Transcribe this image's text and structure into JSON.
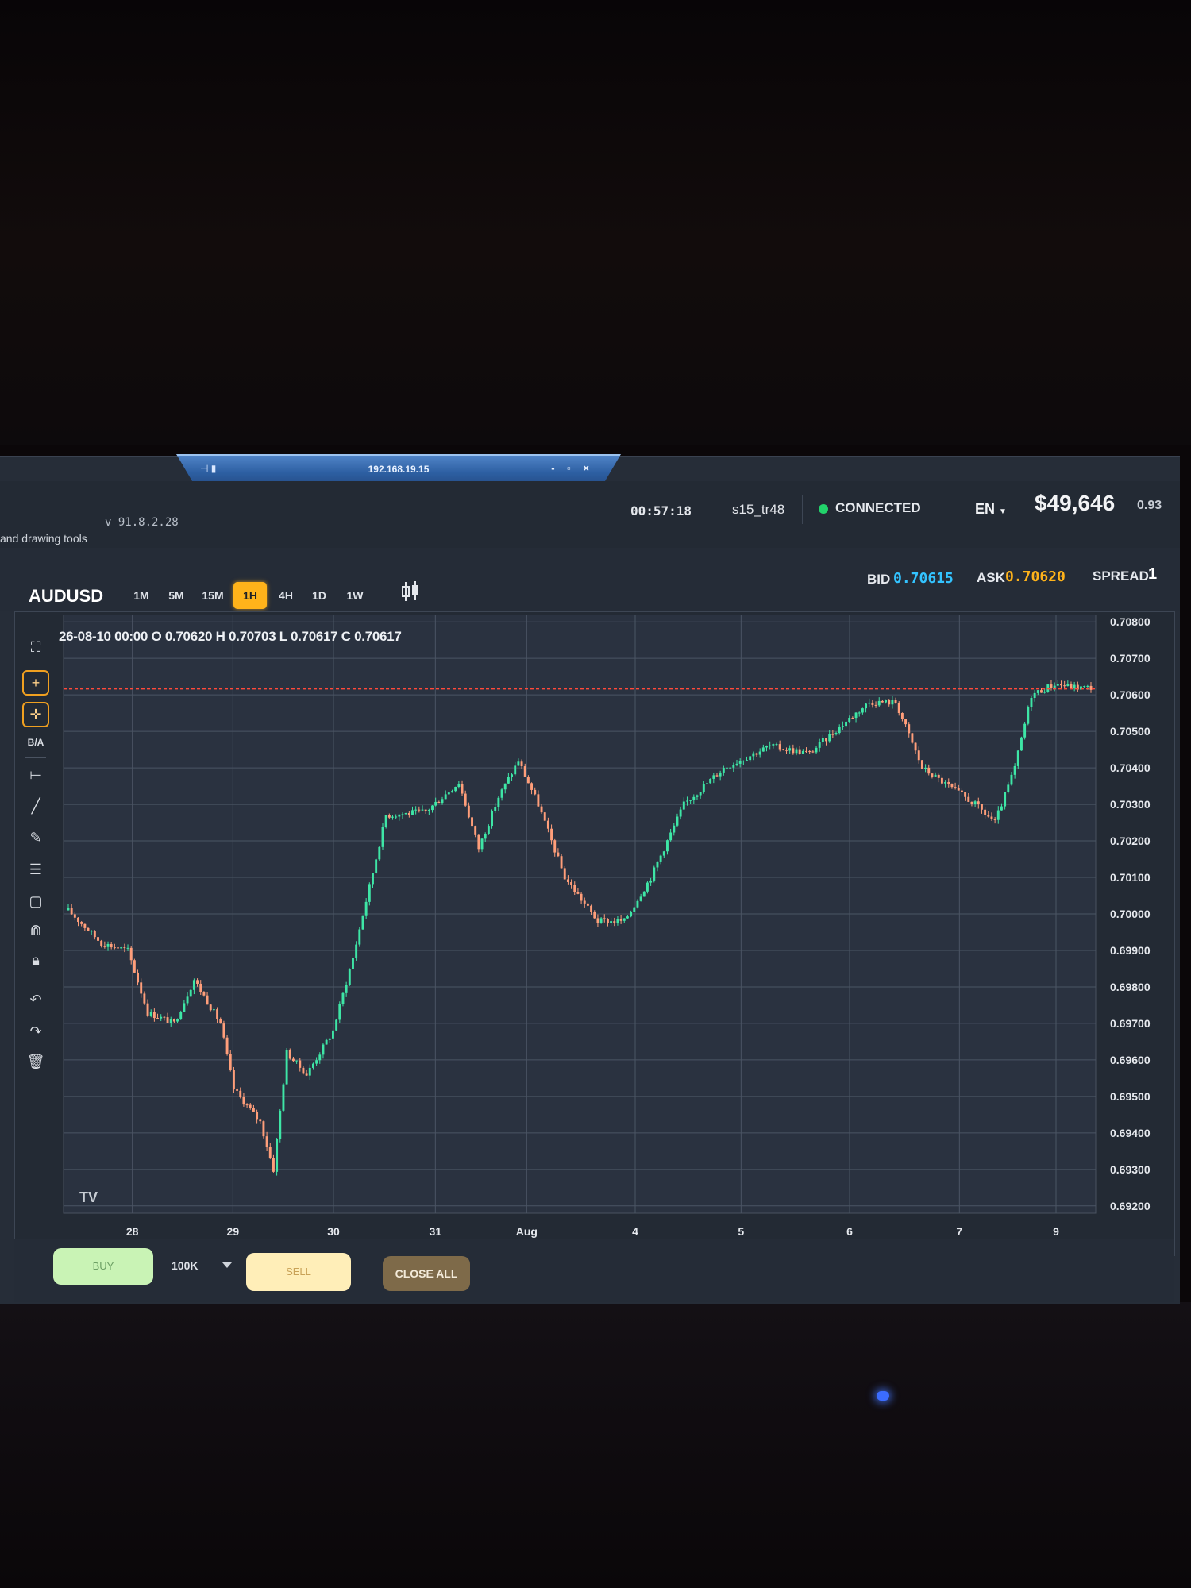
{
  "remote": {
    "ip": "192.168.19.15",
    "pin": "⊣ ▮",
    "controls": "- ▫ ×"
  },
  "status": {
    "version": "v 91.8.2.28",
    "hint": "and drawing tools",
    "clock": "00:57:18",
    "account": "s15_tr48",
    "connection": "CONNECTED",
    "connection_color": "#22d36b",
    "language": "EN",
    "balance": "$49,646",
    "balance_extra": "0.93"
  },
  "toolbar": {
    "symbol": "AUDUSD",
    "timeframes": [
      "1M",
      "5M",
      "15M",
      "1H",
      "4H",
      "1D",
      "1W"
    ],
    "active_timeframe": "1H",
    "chart_type_icon": "candlestick-icon"
  },
  "quote": {
    "bid_label": "BID",
    "bid": "0.70615",
    "ask_label": "ASK",
    "ask": "0.70620",
    "spread_label": "SPREAD",
    "spread": "1",
    "bid_color": "#33c3ff",
    "ask_color": "#ffb31a"
  },
  "ohlc_readout": "26-08-10 00:00 O 0.70620 H 0.70703 L 0.70617 C 0.70617",
  "drawing_tools": [
    "fullscreen-icon",
    "crosshair-icon",
    "crosshair-alt-icon",
    "B/A",
    "horizontal-line-icon",
    "trend-line-icon",
    "pencil-icon",
    "fibonacci-icon",
    "rectangle-icon",
    "magnet-icon",
    "lock-icon",
    "undo-icon",
    "redo-icon",
    "trash-icon"
  ],
  "watermark": "TV",
  "trade": {
    "buy_label": "BUY",
    "lot_size": "100K",
    "sell_label": "SELL",
    "close_all_label": "CLOSE ALL",
    "buy_color": "#c9f3b5",
    "sell_color": "#ffeeb8"
  },
  "chart_data": {
    "type": "candlestick",
    "symbol": "AUDUSD",
    "timeframe": "1H",
    "y_ticks": [
      0.708,
      0.707,
      0.706,
      0.705,
      0.704,
      0.703,
      0.702,
      0.701,
      0.7,
      0.699,
      0.698,
      0.697,
      0.696,
      0.695,
      0.694,
      0.693,
      0.692
    ],
    "y_tick_labels": [
      "0.70800",
      "0.70700",
      "0.70600",
      "0.70500",
      "0.70400",
      "0.70300",
      "0.70200",
      "0.70100",
      "0.70000",
      "0.69900",
      "0.69800",
      "0.69700",
      "0.69600",
      "0.69500",
      "0.69400",
      "0.69300",
      "0.69200"
    ],
    "ylim": [
      0.6918,
      0.7082
    ],
    "x_ticks": [
      "28",
      "29",
      "30",
      "31",
      "Aug",
      "4",
      "5",
      "6",
      "7",
      "9"
    ],
    "price_line": 0.70617,
    "price_line_color": "#ff4a3a",
    "up_color": "#3ee6a6",
    "down_color": "#ff9e7a",
    "grid": true,
    "close_path": [
      [
        0,
        0.7001
      ],
      [
        10,
        0.6992
      ],
      [
        18,
        0.699
      ],
      [
        24,
        0.6973
      ],
      [
        32,
        0.697
      ],
      [
        38,
        0.6982
      ],
      [
        46,
        0.697
      ],
      [
        50,
        0.6952
      ],
      [
        58,
        0.6943
      ],
      [
        62,
        0.693
      ],
      [
        66,
        0.6962
      ],
      [
        72,
        0.6956
      ],
      [
        80,
        0.6968
      ],
      [
        86,
        0.6988
      ],
      [
        96,
        0.7027
      ],
      [
        108,
        0.7028
      ],
      [
        118,
        0.7036
      ],
      [
        124,
        0.7018
      ],
      [
        130,
        0.7032
      ],
      [
        136,
        0.7042
      ],
      [
        142,
        0.703
      ],
      [
        150,
        0.701
      ],
      [
        160,
        0.6998
      ],
      [
        168,
        0.6998
      ],
      [
        176,
        0.701
      ],
      [
        186,
        0.703
      ],
      [
        198,
        0.704
      ],
      [
        212,
        0.7046
      ],
      [
        224,
        0.7044
      ],
      [
        234,
        0.7052
      ],
      [
        242,
        0.7058
      ],
      [
        250,
        0.7058
      ],
      [
        258,
        0.704
      ],
      [
        266,
        0.7035
      ],
      [
        274,
        0.703
      ],
      [
        280,
        0.7025
      ],
      [
        286,
        0.704
      ],
      [
        291,
        0.706
      ],
      [
        298,
        0.7063
      ],
      [
        305,
        0.7062
      ]
    ]
  }
}
